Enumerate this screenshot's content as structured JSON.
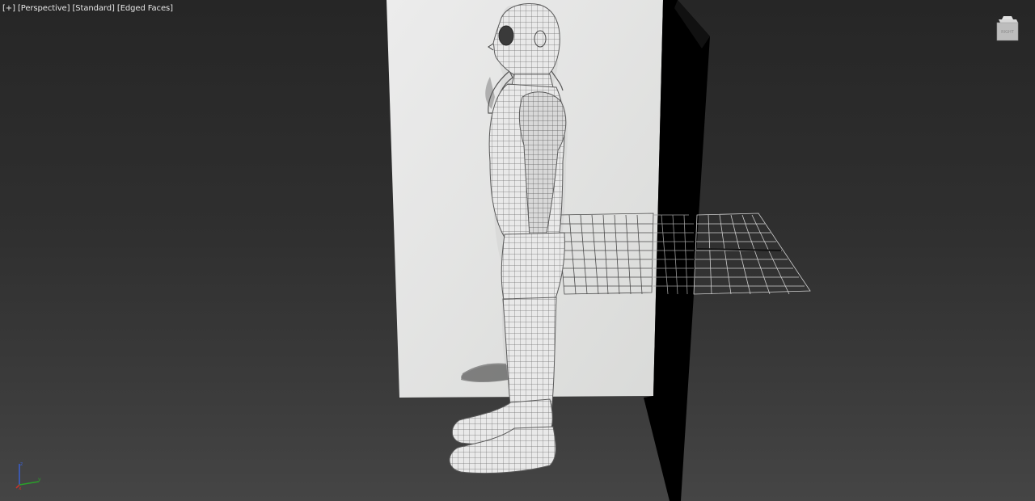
{
  "viewport": {
    "labels": {
      "menu": "[+]",
      "view": "[Perspective]",
      "shading": "[Standard]",
      "display": "[Edged Faces]"
    },
    "viewcube": {
      "face_label": "RIGHT",
      "icon": "viewcube-icon"
    },
    "axis_tripod": {
      "icon": "axis-tripod-icon"
    },
    "colors": {
      "background": "#2f2f2f",
      "reference_plane": "#e3e3e3",
      "wireframe": "#6f6f6f",
      "dark_plane": "#000000",
      "grid": "#cfcfcf",
      "axis_x": "#d0302b",
      "axis_y": "#2aa02a",
      "axis_z": "#3a5fd0"
    }
  }
}
